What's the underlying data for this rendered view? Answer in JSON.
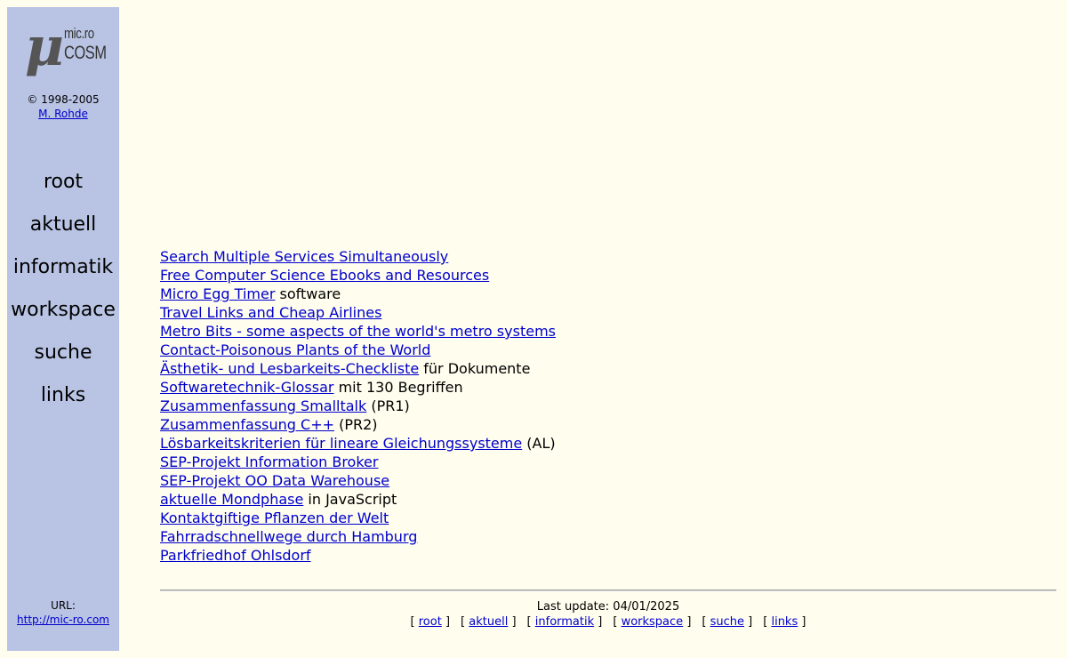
{
  "sidebar": {
    "logo": {
      "symbol": "μ",
      "line1": "mic.ro",
      "line2": "COSM"
    },
    "copyright": "© 1998-2005",
    "author": "M. Rohde",
    "nav": [
      "root",
      "aktuell",
      "informatik",
      "workspace",
      "suche",
      "links"
    ],
    "url_label": "URL:",
    "url": "http://mic-ro.com"
  },
  "main": {
    "items": [
      {
        "link": "Search Multiple Services Simultaneously",
        "suffix": ""
      },
      {
        "link": "Free Computer Science Ebooks and Resources",
        "suffix": ""
      },
      {
        "link": "Micro Egg Timer",
        "suffix": " software"
      },
      {
        "link": "Travel Links and Cheap Airlines",
        "suffix": ""
      },
      {
        "link": "Metro Bits - some aspects of the world's metro systems",
        "suffix": ""
      },
      {
        "link": "Contact-Poisonous Plants of the World",
        "suffix": ""
      },
      {
        "link": "Ästhetik- und Lesbarkeits-Checkliste",
        "suffix": " für Dokumente"
      },
      {
        "link": "Softwaretechnik-Glossar",
        "suffix": " mit 130 Begriffen"
      },
      {
        "link": "Zusammenfassung Smalltalk",
        "suffix": " (PR1)"
      },
      {
        "link": "Zusammenfassung C++",
        "suffix": " (PR2)"
      },
      {
        "link": "Lösbarkeitskriterien für lineare Gleichungssysteme",
        "suffix": " (AL)"
      },
      {
        "link": "SEP-Projekt Information Broker",
        "suffix": ""
      },
      {
        "link": "SEP-Projekt OO Data Warehouse",
        "suffix": ""
      },
      {
        "link": "aktuelle Mondphase",
        "suffix": " in JavaScript"
      },
      {
        "link": "Kontaktgiftige Pflanzen der Welt",
        "suffix": ""
      },
      {
        "link": "Fahrradschnellwege durch Hamburg",
        "suffix": ""
      },
      {
        "link": "Parkfriedhof Ohlsdorf",
        "suffix": ""
      }
    ]
  },
  "footer": {
    "last_update": "Last update: 04/01/2025",
    "links": [
      "root",
      "aktuell",
      "informatik",
      "workspace",
      "suche",
      "links"
    ]
  },
  "colors": {
    "background": "#fefdee",
    "sidebar": "#b9c4e4",
    "link": "#0000cc"
  }
}
